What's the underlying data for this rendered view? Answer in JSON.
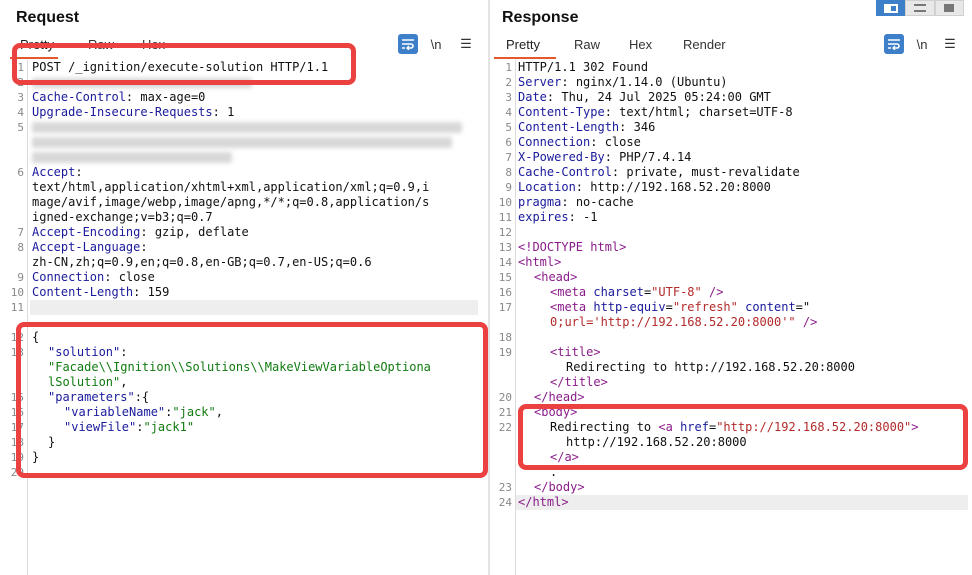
{
  "request": {
    "title": "Request",
    "tabs": [
      "Pretty",
      "Raw",
      "Hex"
    ],
    "tools": {
      "wrap_icon": "word-wrap-icon",
      "newline_label": "\\n",
      "menu_icon": "hamburger-icon"
    },
    "line_numbers": [
      "1",
      "2",
      "3",
      "4",
      "5",
      "",
      "",
      "6",
      "",
      "",
      "",
      "7",
      "8",
      "",
      "9",
      "10",
      "11",
      "12",
      "13",
      "14",
      "",
      "",
      "15",
      "16",
      "17",
      "18",
      "19",
      "20"
    ],
    "lines": {
      "l1": "POST /_ignition/execute-solution HTTP/1.1",
      "l3k": "Cache-Control",
      "l3v": " max-age=0",
      "l4k": "Upgrade-Insecure-Requests",
      "l4v": " 1",
      "l6k": "Accept",
      "l6a": "text/html,application/xhtml+xml,application/xml;q=0.9,i",
      "l6b": "mage/avif,image/webp,image/apng,*/*;q=0.8,application/s",
      "l6c": "igned-exchange;v=b3;q=0.7",
      "l7k": "Accept-Encoding",
      "l7v": " gzip, deflate",
      "l8k": "Accept-Language",
      "l8v": "zh-CN,zh;q=0.9,en;q=0.8,en-GB;q=0.7,en-US;q=0.6",
      "l9k": "Connection",
      "l9v": " close",
      "l10k": "Content-Length",
      "l10v": " 159",
      "b1": "{",
      "b2k": "\"solution\"",
      "b2p": ":",
      "b3": "\"Facade\\\\Ignition\\\\Solutions\\\\MakeViewVariableOptiona",
      "b4": "lSolution\"",
      "b5k": "\"parameters\"",
      "b5p": ":{",
      "b6k": "\"variableName\"",
      "b6v": "\"jack\"",
      "b7k": "\"viewFile\"",
      "b7v": "\"jack1\"",
      "b8": "}",
      "b9": "}"
    }
  },
  "response": {
    "title": "Response",
    "tabs": [
      "Pretty",
      "Raw",
      "Hex",
      "Render"
    ],
    "tools": {
      "wrap_icon": "word-wrap-icon",
      "newline_label": "\\n",
      "menu_icon": "hamburger-icon"
    },
    "line_numbers": [
      "1",
      "2",
      "3",
      "4",
      "5",
      "6",
      "7",
      "8",
      "9",
      "10",
      "11",
      "12",
      "13",
      "14",
      "15",
      "16",
      "17",
      "",
      "18",
      "19",
      "",
      "",
      "20",
      "21",
      "22",
      "",
      "",
      "23",
      "24"
    ],
    "lines": {
      "r1": "HTTP/1.1 302 Found",
      "r2k": "Server",
      "r2v": " nginx/1.14.0 (Ubuntu)",
      "r3k": "Date",
      "r3v": " Thu, 24 Jul 2025 05:24:00 GMT",
      "r4k": "Content-Type",
      "r4v": " text/html; charset=UTF-8",
      "r5k": "Content-Length",
      "r5v": " 346",
      "r6k": "Connection",
      "r6v": " close",
      "r7k": "X-Powered-By",
      "r7v": " PHP/7.4.14",
      "r8k": "Cache-Control",
      "r8v": " private, must-revalidate",
      "r9k": "Location",
      "r9v": " http://192.168.52.20:8000",
      "r10k": "pragma",
      "r10v": " no-cache",
      "r11k": "expires",
      "r11v": " -1",
      "h13": "<!DOCTYPE html>",
      "h14": "<html>",
      "h15": "<head>",
      "h16a": "<meta ",
      "h16b": "charset",
      "h16c": "=",
      "h16d": "\"UTF-8\"",
      "h16e": " />",
      "h17a": "<meta ",
      "h17b": "http-equiv",
      "h17c": "=",
      "h17d": "\"refresh\"",
      "h17e": " content",
      "h17f": "=\"",
      "h17g": "0;url='http://192.168.52.20:8000'\"",
      "h17h": " />",
      "h18": "<title>",
      "h18t": "Redirecting to http://192.168.52.20:8000",
      "h18c": "</title>",
      "h20": "</head>",
      "h21": "<body>",
      "h22a": "Redirecting to ",
      "h22b": "<a ",
      "h22c": "href",
      "h22d": "=",
      "h22e": "\"http://192.168.52.20:8000\"",
      "h22f": ">",
      "h22g": "http://192.168.52.20:8000",
      "h22h": "</a>",
      "h22i": ".",
      "h23": "</body>",
      "h24": "</html>"
    }
  },
  "view_switch": {
    "options": [
      "split-horizontal-icon",
      "split-vertical-icon",
      "single-pane-icon"
    ],
    "active_index": 0
  },
  "colors": {
    "accent": "#e5572d",
    "highlight_box": "#ec4141",
    "wrap_button": "#3d7fc9"
  }
}
